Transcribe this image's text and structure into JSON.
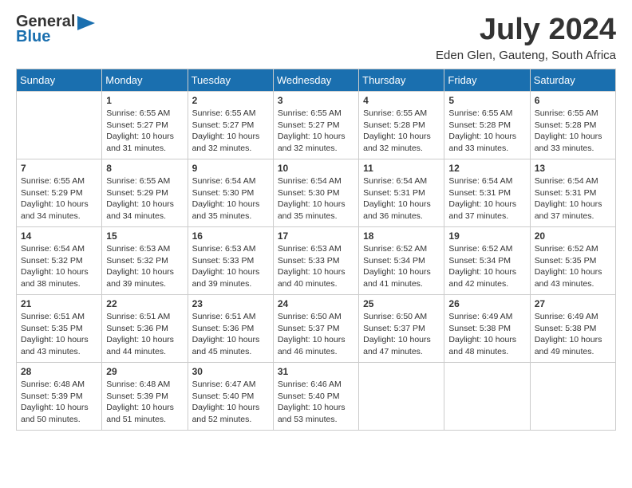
{
  "header": {
    "logo_general": "General",
    "logo_blue": "Blue",
    "month_year": "July 2024",
    "location": "Eden Glen, Gauteng, South Africa"
  },
  "days_of_week": [
    "Sunday",
    "Monday",
    "Tuesday",
    "Wednesday",
    "Thursday",
    "Friday",
    "Saturday"
  ],
  "weeks": [
    [
      {
        "day": "",
        "info": ""
      },
      {
        "day": "1",
        "info": "Sunrise: 6:55 AM\nSunset: 5:27 PM\nDaylight: 10 hours\nand 31 minutes."
      },
      {
        "day": "2",
        "info": "Sunrise: 6:55 AM\nSunset: 5:27 PM\nDaylight: 10 hours\nand 32 minutes."
      },
      {
        "day": "3",
        "info": "Sunrise: 6:55 AM\nSunset: 5:27 PM\nDaylight: 10 hours\nand 32 minutes."
      },
      {
        "day": "4",
        "info": "Sunrise: 6:55 AM\nSunset: 5:28 PM\nDaylight: 10 hours\nand 32 minutes."
      },
      {
        "day": "5",
        "info": "Sunrise: 6:55 AM\nSunset: 5:28 PM\nDaylight: 10 hours\nand 33 minutes."
      },
      {
        "day": "6",
        "info": "Sunrise: 6:55 AM\nSunset: 5:28 PM\nDaylight: 10 hours\nand 33 minutes."
      }
    ],
    [
      {
        "day": "7",
        "info": ""
      },
      {
        "day": "8",
        "info": "Sunrise: 6:55 AM\nSunset: 5:29 PM\nDaylight: 10 hours\nand 34 minutes."
      },
      {
        "day": "9",
        "info": "Sunrise: 6:54 AM\nSunset: 5:30 PM\nDaylight: 10 hours\nand 35 minutes."
      },
      {
        "day": "10",
        "info": "Sunrise: 6:54 AM\nSunset: 5:30 PM\nDaylight: 10 hours\nand 35 minutes."
      },
      {
        "day": "11",
        "info": "Sunrise: 6:54 AM\nSunset: 5:31 PM\nDaylight: 10 hours\nand 36 minutes."
      },
      {
        "day": "12",
        "info": "Sunrise: 6:54 AM\nSunset: 5:31 PM\nDaylight: 10 hours\nand 37 minutes."
      },
      {
        "day": "13",
        "info": "Sunrise: 6:54 AM\nSunset: 5:31 PM\nDaylight: 10 hours\nand 37 minutes."
      }
    ],
    [
      {
        "day": "14",
        "info": ""
      },
      {
        "day": "15",
        "info": "Sunrise: 6:53 AM\nSunset: 5:32 PM\nDaylight: 10 hours\nand 39 minutes."
      },
      {
        "day": "16",
        "info": "Sunrise: 6:53 AM\nSunset: 5:33 PM\nDaylight: 10 hours\nand 39 minutes."
      },
      {
        "day": "17",
        "info": "Sunrise: 6:53 AM\nSunset: 5:33 PM\nDaylight: 10 hours\nand 40 minutes."
      },
      {
        "day": "18",
        "info": "Sunrise: 6:52 AM\nSunset: 5:34 PM\nDaylight: 10 hours\nand 41 minutes."
      },
      {
        "day": "19",
        "info": "Sunrise: 6:52 AM\nSunset: 5:34 PM\nDaylight: 10 hours\nand 42 minutes."
      },
      {
        "day": "20",
        "info": "Sunrise: 6:52 AM\nSunset: 5:35 PM\nDaylight: 10 hours\nand 43 minutes."
      }
    ],
    [
      {
        "day": "21",
        "info": ""
      },
      {
        "day": "22",
        "info": "Sunrise: 6:51 AM\nSunset: 5:36 PM\nDaylight: 10 hours\nand 44 minutes."
      },
      {
        "day": "23",
        "info": "Sunrise: 6:51 AM\nSunset: 5:36 PM\nDaylight: 10 hours\nand 45 minutes."
      },
      {
        "day": "24",
        "info": "Sunrise: 6:50 AM\nSunset: 5:37 PM\nDaylight: 10 hours\nand 46 minutes."
      },
      {
        "day": "25",
        "info": "Sunrise: 6:50 AM\nSunset: 5:37 PM\nDaylight: 10 hours\nand 47 minutes."
      },
      {
        "day": "26",
        "info": "Sunrise: 6:49 AM\nSunset: 5:38 PM\nDaylight: 10 hours\nand 48 minutes."
      },
      {
        "day": "27",
        "info": "Sunrise: 6:49 AM\nSunset: 5:38 PM\nDaylight: 10 hours\nand 49 minutes."
      }
    ],
    [
      {
        "day": "28",
        "info": ""
      },
      {
        "day": "29",
        "info": "Sunrise: 6:48 AM\nSunset: 5:39 PM\nDaylight: 10 hours\nand 51 minutes."
      },
      {
        "day": "30",
        "info": "Sunrise: 6:47 AM\nSunset: 5:40 PM\nDaylight: 10 hours\nand 52 minutes."
      },
      {
        "day": "31",
        "info": "Sunrise: 6:46 AM\nSunset: 5:40 PM\nDaylight: 10 hours\nand 53 minutes."
      },
      {
        "day": "",
        "info": ""
      },
      {
        "day": "",
        "info": ""
      },
      {
        "day": "",
        "info": ""
      }
    ]
  ],
  "week1_day7_info": "Sunrise: 6:55 AM\nSunset: 5:29 PM\nDaylight: 10 hours\nand 34 minutes.",
  "week2_day14_info": "Sunrise: 6:54 AM\nSunset: 5:32 PM\nDaylight: 10 hours\nand 38 minutes.",
  "week3_day21_info": "Sunrise: 6:51 AM\nSunset: 5:35 PM\nDaylight: 10 hours\nand 43 minutes.",
  "week4_day28_info": "Sunrise: 6:48 AM\nSunset: 5:39 PM\nDaylight: 10 hours\nand 50 minutes."
}
